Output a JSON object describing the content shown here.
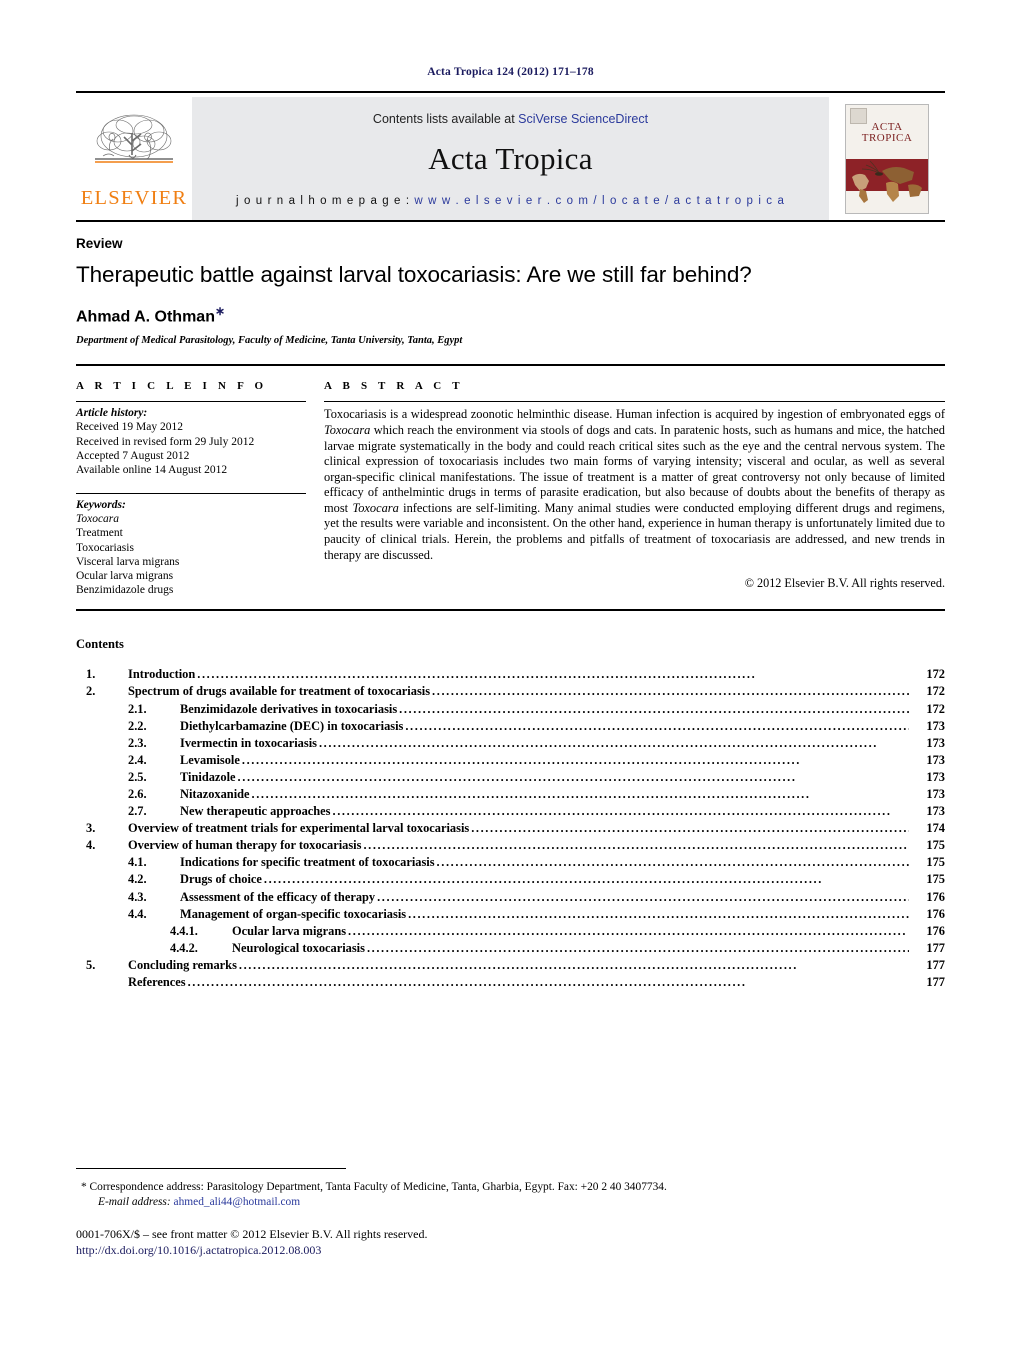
{
  "running_head": "Acta Tropica 124 (2012) 171–178",
  "masthead": {
    "contents_prefix": "Contents lists available at ",
    "contents_link": "SciVerse ScienceDirect",
    "journal_name": "Acta Tropica",
    "homepage_prefix": "j o u r n a l   h o m e p a g e :   ",
    "homepage_url": "w w w . e l s e v i e r . c o m / l o c a t e / a c t a t r o p i c a",
    "publisher_logo_text": "ELSEVIER",
    "cover_title_line1": "ACTA",
    "cover_title_line2": "TROPICA",
    "accent_orange": "#f07f13",
    "cover_red": "#8d2227",
    "link_blue": "#2b3a9c"
  },
  "article": {
    "doctype": "Review",
    "title": "Therapeutic battle against larval toxocariasis: Are we still far behind?",
    "author": "Ahmad A. Othman",
    "author_footnote_mark": "∗",
    "affiliation": "Department of Medical Parasitology, Faculty of Medicine, Tanta University, Tanta, Egypt"
  },
  "article_info": {
    "section_label": "A R T I C L E  I N F O",
    "history_title": "Article history:",
    "history": [
      "Received 19 May 2012",
      "Received in revised form 29 July 2012",
      "Accepted 7 August 2012",
      "Available online 14 August 2012"
    ],
    "keywords_title": "Keywords:",
    "keywords": [
      "Toxocara",
      "Treatment",
      "Toxocariasis",
      "Visceral larva migrans",
      "Ocular larva migrans",
      "Benzimidazole drugs"
    ]
  },
  "abstract": {
    "section_label": "A B S T R A C T",
    "paragraph_part1": "Toxocariasis is a widespread zoonotic helminthic disease. Human infection is acquired by ingestion of embryonated eggs of ",
    "italic1": "Toxocara",
    "paragraph_part2": " which reach the environment via stools of dogs and cats. In paratenic hosts, such as humans and mice, the hatched larvae migrate systematically in the body and could reach critical sites such as the eye and the central nervous system. The clinical expression of toxocariasis includes two main forms of varying intensity; visceral and ocular, as well as several organ-specific clinical manifestations. The issue of treatment is a matter of great controversy not only because of limited efficacy of anthelmintic drugs in terms of parasite eradication, but also because of doubts about the benefits of therapy as most ",
    "italic2": "Toxocara",
    "paragraph_part3": " infections are self-limiting. Many animal studies were conducted employing different drugs and regimens, yet the results were variable and inconsistent. On the other hand, experience in human therapy is unfortunately limited due to paucity of clinical trials. Herein, the problems and pitfalls of treatment of toxocariasis are addressed, and new trends in therapy are discussed.",
    "copyright": "© 2012 Elsevier B.V. All rights reserved."
  },
  "contents": {
    "heading": "Contents",
    "entries": [
      {
        "level": 1,
        "num": "1.",
        "label": "Introduction",
        "page": "172"
      },
      {
        "level": 1,
        "num": "2.",
        "label": "Spectrum of drugs available for treatment of toxocariasis",
        "page": "172"
      },
      {
        "level": 2,
        "num": "2.1.",
        "label": "Benzimidazole derivatives in toxocariasis",
        "page": "172"
      },
      {
        "level": 2,
        "num": "2.2.",
        "label": "Diethylcarbamazine (DEC) in toxocariasis",
        "page": "173"
      },
      {
        "level": 2,
        "num": "2.3.",
        "label": "Ivermectin in toxocariasis",
        "page": "173"
      },
      {
        "level": 2,
        "num": "2.4.",
        "label": "Levamisole",
        "page": "173"
      },
      {
        "level": 2,
        "num": "2.5.",
        "label": "Tinidazole",
        "page": "173"
      },
      {
        "level": 2,
        "num": "2.6.",
        "label": "Nitazoxanide",
        "page": "173"
      },
      {
        "level": 2,
        "num": "2.7.",
        "label": "New therapeutic approaches",
        "page": "173"
      },
      {
        "level": 1,
        "num": "3.",
        "label": "Overview of treatment trials for experimental larval toxocariasis",
        "page": "174"
      },
      {
        "level": 1,
        "num": "4.",
        "label": "Overview of human therapy for toxocariasis",
        "page": "175"
      },
      {
        "level": 2,
        "num": "4.1.",
        "label": "Indications for specific treatment of toxocariasis",
        "page": "175"
      },
      {
        "level": 2,
        "num": "4.2.",
        "label": "Drugs of choice",
        "page": "175"
      },
      {
        "level": 2,
        "num": "4.3.",
        "label": "Assessment of the efficacy of therapy",
        "page": "176"
      },
      {
        "level": 2,
        "num": "4.4.",
        "label": "Management of organ-specific toxocariasis",
        "page": "176"
      },
      {
        "level": 3,
        "num": "4.4.1.",
        "label": "Ocular larva migrans",
        "page": "176"
      },
      {
        "level": 3,
        "num": "4.4.2.",
        "label": "Neurological toxocariasis",
        "page": "177"
      },
      {
        "level": 1,
        "num": "5.",
        "label": "Concluding remarks",
        "page": "177"
      },
      {
        "level": 0,
        "num": "",
        "label": "References",
        "page": "177"
      }
    ]
  },
  "footnotes": {
    "correspondence": "* Correspondence address: Parasitology Department, Tanta Faculty of Medicine, Tanta, Gharbia, Egypt. Fax: +20 2 40 3407734.",
    "email_label": "E-mail address:",
    "email": "ahmed_ali44@hotmail.com",
    "issn_line": "0001-706X/$ – see front matter © 2012 Elsevier B.V. All rights reserved.",
    "doi": "http://dx.doi.org/10.1016/j.actatropica.2012.08.003"
  }
}
